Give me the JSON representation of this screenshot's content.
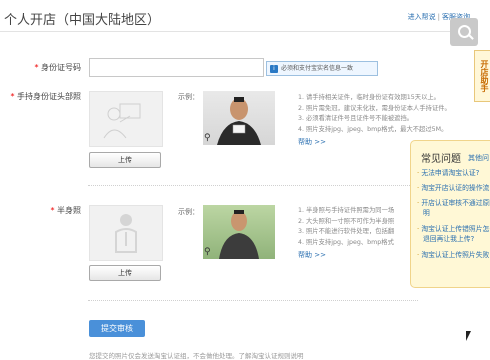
{
  "header": {
    "title": "个人开店（中国大陆地区）",
    "links": [
      "进入帮说",
      "客服咨询"
    ],
    "side_tab": "开店助手"
  },
  "form": {
    "id_number": {
      "label": "身份证号码",
      "value": "",
      "hint": "必须和支付宝实名信息一致"
    },
    "handheld_photo": {
      "label": "手持身份证头部照",
      "upload_button": "上传",
      "example_label": "示例：",
      "rules": [
        "1. 请手持相关证件，临时身份证有效期15天以上。",
        "2. 照片需免冠，建议未化妆，需身份证本人手持证件。",
        "3. 必须看清证件号且证件号不能被遮挡。",
        "4. 照片支持jpg、jpeg、bmp格式，最大不超过5M。"
      ],
      "help_link": "帮助 >>"
    },
    "half_body_photo": {
      "label": "半身照",
      "upload_button": "上传",
      "example_label": "示例：",
      "rules": [
        "1. 半身照与手持证件照需为同一场",
        "2. 大头照和一寸照不可作为半身照",
        "3. 照片不能进行软件处理，包括翻",
        "4. 照片支持jpg、jpeg、bmp格式"
      ],
      "help_link": "帮助 >>"
    },
    "submit_button": "提交审核"
  },
  "faq": {
    "title": "常见问题",
    "more": "其他问",
    "items": [
      "无法申请淘宝认证?",
      "淘宝开店认证的操作流",
      "开店认证审核不通过原因",
      "明",
      "淘宝认证上传错照片怎么",
      "退回再让我上传?",
      "淘宝认证上传照片失败"
    ]
  },
  "bottom_note": "您提交的照片仅会发送淘宝认证组，不会做他处理。了解淘宝认证规则说明"
}
